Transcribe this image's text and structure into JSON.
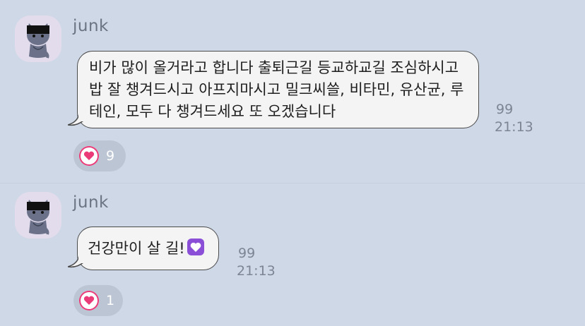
{
  "messages": [
    {
      "sender": "junk",
      "text": "비가 많이 올거라고 합니다 출퇴근길 등교하교길 조심하시고\n밥 잘 챙겨드시고 아프지마시고 밀크씨쓸, 비타민, 유산균, 루\n테인, 모두 다 챙겨드세요 또 오겠습니다",
      "unread": "99",
      "time": "21:13",
      "reaction_count": "9",
      "reaction_icon": "heart-icon"
    },
    {
      "sender": "junk",
      "text": "건강만이 살 길!",
      "emoji": "purple-heart-emoji",
      "unread": "99",
      "time": "21:13",
      "reaction_count": "1",
      "reaction_icon": "heart-icon"
    }
  ],
  "colors": {
    "background": "#ced8e7",
    "bubble": "#f4f4f4",
    "heart": "#ea3a78",
    "emoji_heart": "#8a4fd6"
  }
}
